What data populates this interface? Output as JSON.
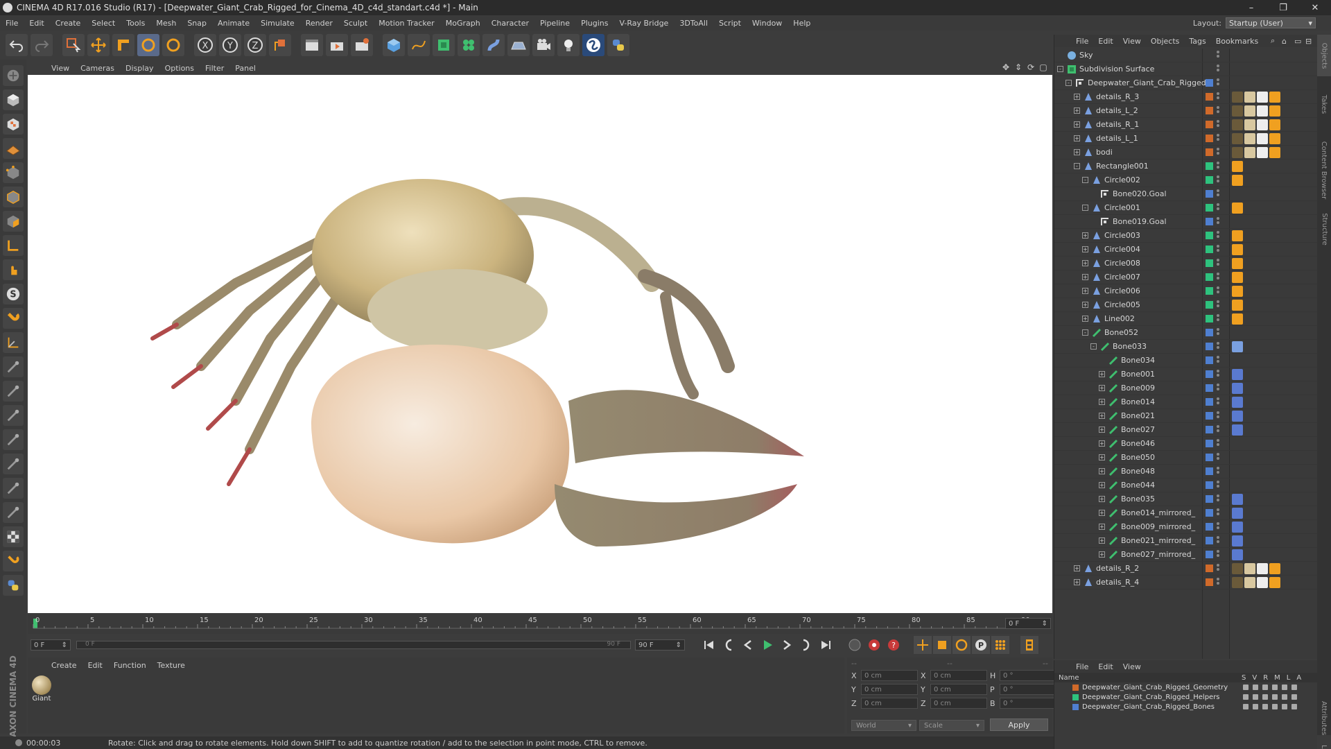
{
  "window": {
    "title": "CINEMA 4D R17.016 Studio (R17) - [Deepwater_Giant_Crab_Rigged_for_Cinema_4D_c4d_standart.c4d *] - Main",
    "minimize": "–",
    "maximize": "❐",
    "close": "✕"
  },
  "menubar": {
    "items": [
      "File",
      "Edit",
      "Create",
      "Select",
      "Tools",
      "Mesh",
      "Snap",
      "Animate",
      "Simulate",
      "Render",
      "Sculpt",
      "Motion Tracker",
      "MoGraph",
      "Character",
      "Pipeline",
      "Plugins",
      "V-Ray Bridge",
      "3DToAll",
      "Script",
      "Window",
      "Help"
    ],
    "layout_label": "Layout:",
    "layout_value": "Startup (User)"
  },
  "viewport": {
    "menu": [
      "View",
      "Cameras",
      "Display",
      "Options",
      "Filter",
      "Panel"
    ]
  },
  "timeline": {
    "ticks": [
      "0",
      "5",
      "10",
      "15",
      "20",
      "25",
      "30",
      "35",
      "40",
      "45",
      "50",
      "55",
      "60",
      "65",
      "70",
      "75",
      "80",
      "85",
      "90"
    ],
    "end_frame_field": "0 F",
    "current_frame": "0 F",
    "range_start": "0 F",
    "range_end": "90 F",
    "max_frame": "90 F"
  },
  "material_manager": {
    "menu": [
      "Create",
      "Edit",
      "Function",
      "Texture"
    ],
    "materials": [
      {
        "name": "Giant"
      }
    ]
  },
  "coordinates": {
    "rows": [
      {
        "axis": "X",
        "pos": "0 cm",
        "size_axis": "X",
        "size": "0 cm",
        "rot_axis": "H",
        "rot": "0 °"
      },
      {
        "axis": "Y",
        "pos": "0 cm",
        "size_axis": "Y",
        "size": "0 cm",
        "rot_axis": "P",
        "rot": "0 °"
      },
      {
        "axis": "Z",
        "pos": "0 cm",
        "size_axis": "Z",
        "size": "0 cm",
        "rot_axis": "B",
        "rot": "0 °"
      }
    ],
    "mode": "World",
    "scale": "Scale",
    "apply": "Apply",
    "header_left": "--",
    "header_mid": "--",
    "header_right": "--"
  },
  "status": {
    "time": "00:00:03",
    "message": "Rotate: Click and drag to rotate elements. Hold down SHIFT to add to quantize rotation / add to the selection in point mode, CTRL to remove."
  },
  "object_manager": {
    "menu": [
      "File",
      "Edit",
      "View",
      "Objects",
      "Tags",
      "Bookmarks"
    ],
    "objects": [
      {
        "name": "Sky",
        "depth": 0,
        "kind": "sky",
        "exp": "",
        "layer": "",
        "tags": []
      },
      {
        "name": "Subdivision Surface",
        "depth": 0,
        "kind": "subd",
        "exp": "-",
        "layer": "",
        "tags": []
      },
      {
        "name": "Deepwater_Giant_Crab_Rigged",
        "depth": 1,
        "kind": "null",
        "exp": "-",
        "layer": "#4f7fd0",
        "tags": []
      },
      {
        "name": "details_R_3",
        "depth": 2,
        "kind": "joint",
        "exp": "+",
        "layer": "#d06a2a",
        "tags": [
          "phong",
          "mat",
          "check",
          "weight"
        ]
      },
      {
        "name": "details_L_2",
        "depth": 2,
        "kind": "joint",
        "exp": "+",
        "layer": "#d06a2a",
        "tags": [
          "phong",
          "mat",
          "check",
          "weight"
        ]
      },
      {
        "name": "details_R_1",
        "depth": 2,
        "kind": "joint",
        "exp": "+",
        "layer": "#d06a2a",
        "tags": [
          "phong",
          "mat",
          "check",
          "weight"
        ]
      },
      {
        "name": "details_L_1",
        "depth": 2,
        "kind": "joint",
        "exp": "+",
        "layer": "#d06a2a",
        "tags": [
          "phong",
          "mat",
          "check",
          "weight"
        ]
      },
      {
        "name": "bodi",
        "depth": 2,
        "kind": "joint",
        "exp": "+",
        "layer": "#d06a2a",
        "tags": [
          "phong",
          "mat",
          "check",
          "weight"
        ]
      },
      {
        "name": "Rectangle001",
        "depth": 2,
        "kind": "spline",
        "exp": "-",
        "layer": "#2ec27e",
        "tags": [
          "weight"
        ]
      },
      {
        "name": "Circle002",
        "depth": 3,
        "kind": "spline",
        "exp": "-",
        "layer": "#2ec27e",
        "tags": [
          "weight"
        ]
      },
      {
        "name": "Bone020.Goal",
        "depth": 4,
        "kind": "null",
        "exp": "",
        "layer": "#4f7fd0",
        "tags": []
      },
      {
        "name": "Circle001",
        "depth": 3,
        "kind": "spline",
        "exp": "-",
        "layer": "#2ec27e",
        "tags": [
          "weight"
        ]
      },
      {
        "name": "Bone019.Goal",
        "depth": 4,
        "kind": "null",
        "exp": "",
        "layer": "#4f7fd0",
        "tags": []
      },
      {
        "name": "Circle003",
        "depth": 3,
        "kind": "spline",
        "exp": "+",
        "layer": "#2ec27e",
        "tags": [
          "weight"
        ]
      },
      {
        "name": "Circle004",
        "depth": 3,
        "kind": "spline",
        "exp": "+",
        "layer": "#2ec27e",
        "tags": [
          "weight"
        ]
      },
      {
        "name": "Circle008",
        "depth": 3,
        "kind": "spline",
        "exp": "+",
        "layer": "#2ec27e",
        "tags": [
          "weight"
        ]
      },
      {
        "name": "Circle007",
        "depth": 3,
        "kind": "spline",
        "exp": "+",
        "layer": "#2ec27e",
        "tags": [
          "weight"
        ]
      },
      {
        "name": "Circle006",
        "depth": 3,
        "kind": "spline",
        "exp": "+",
        "layer": "#2ec27e",
        "tags": [
          "weight"
        ]
      },
      {
        "name": "Circle005",
        "depth": 3,
        "kind": "spline",
        "exp": "+",
        "layer": "#2ec27e",
        "tags": [
          "weight"
        ]
      },
      {
        "name": "Line002",
        "depth": 3,
        "kind": "spline",
        "exp": "+",
        "layer": "#2ec27e",
        "tags": [
          "weight"
        ]
      },
      {
        "name": "Bone052",
        "depth": 3,
        "kind": "bone",
        "exp": "-",
        "layer": "#4f7fd0",
        "tags": []
      },
      {
        "name": "Bone033",
        "depth": 4,
        "kind": "bone",
        "exp": "-",
        "layer": "#4f7fd0",
        "tags": [
          "ik"
        ]
      },
      {
        "name": "Bone034",
        "depth": 5,
        "kind": "bone",
        "exp": "",
        "layer": "#4f7fd0",
        "tags": []
      },
      {
        "name": "Bone001",
        "depth": 5,
        "kind": "bone",
        "exp": "+",
        "layer": "#4f7fd0",
        "tags": [
          "ikblue"
        ]
      },
      {
        "name": "Bone009",
        "depth": 5,
        "kind": "bone",
        "exp": "+",
        "layer": "#4f7fd0",
        "tags": [
          "ikblue"
        ]
      },
      {
        "name": "Bone014",
        "depth": 5,
        "kind": "bone",
        "exp": "+",
        "layer": "#4f7fd0",
        "tags": [
          "ikblue"
        ]
      },
      {
        "name": "Bone021",
        "depth": 5,
        "kind": "bone",
        "exp": "+",
        "layer": "#4f7fd0",
        "tags": [
          "ikblue"
        ]
      },
      {
        "name": "Bone027",
        "depth": 5,
        "kind": "bone",
        "exp": "+",
        "layer": "#4f7fd0",
        "tags": [
          "ikblue"
        ]
      },
      {
        "name": "Bone046",
        "depth": 5,
        "kind": "bone",
        "exp": "+",
        "layer": "#4f7fd0",
        "tags": []
      },
      {
        "name": "Bone050",
        "depth": 5,
        "kind": "bone",
        "exp": "+",
        "layer": "#4f7fd0",
        "tags": []
      },
      {
        "name": "Bone048",
        "depth": 5,
        "kind": "bone",
        "exp": "+",
        "layer": "#4f7fd0",
        "tags": []
      },
      {
        "name": "Bone044",
        "depth": 5,
        "kind": "bone",
        "exp": "+",
        "layer": "#4f7fd0",
        "tags": []
      },
      {
        "name": "Bone035",
        "depth": 5,
        "kind": "bone",
        "exp": "+",
        "layer": "#4f7fd0",
        "tags": [
          "ikblue"
        ]
      },
      {
        "name": "Bone014_mirrored_",
        "depth": 5,
        "kind": "bone",
        "exp": "+",
        "layer": "#4f7fd0",
        "tags": [
          "ikblue"
        ]
      },
      {
        "name": "Bone009_mirrored_",
        "depth": 5,
        "kind": "bone",
        "exp": "+",
        "layer": "#4f7fd0",
        "tags": [
          "ikblue"
        ]
      },
      {
        "name": "Bone021_mirrored_",
        "depth": 5,
        "kind": "bone",
        "exp": "+",
        "layer": "#4f7fd0",
        "tags": [
          "ikblue"
        ]
      },
      {
        "name": "Bone027_mirrored_",
        "depth": 5,
        "kind": "bone",
        "exp": "+",
        "layer": "#4f7fd0",
        "tags": [
          "ikblue"
        ]
      },
      {
        "name": "details_R_2",
        "depth": 2,
        "kind": "joint",
        "exp": "+",
        "layer": "#d06a2a",
        "tags": [
          "phong",
          "mat",
          "check",
          "weight"
        ]
      },
      {
        "name": "details_R_4",
        "depth": 2,
        "kind": "joint",
        "exp": "+",
        "layer": "#d06a2a",
        "tags": [
          "phong",
          "mat",
          "check",
          "weight"
        ]
      }
    ]
  },
  "side_tabs": [
    "Objects",
    "Takes",
    "Content Browser",
    "Structure",
    "Attributes",
    "Layers"
  ],
  "layer_manager": {
    "menu": [
      "File",
      "Edit",
      "View"
    ],
    "header_name": "Name",
    "header_cols": [
      "S",
      "V",
      "R",
      "M",
      "L",
      "A"
    ],
    "layers": [
      {
        "name": "Deepwater_Giant_Crab_Rigged_Geometry",
        "color": "#d06a2a"
      },
      {
        "name": "Deepwater_Giant_Crab_Rigged_Helpers",
        "color": "#2ec27e"
      },
      {
        "name": "Deepwater_Giant_Crab_Rigged_Bones",
        "color": "#4f7fd0"
      }
    ]
  }
}
